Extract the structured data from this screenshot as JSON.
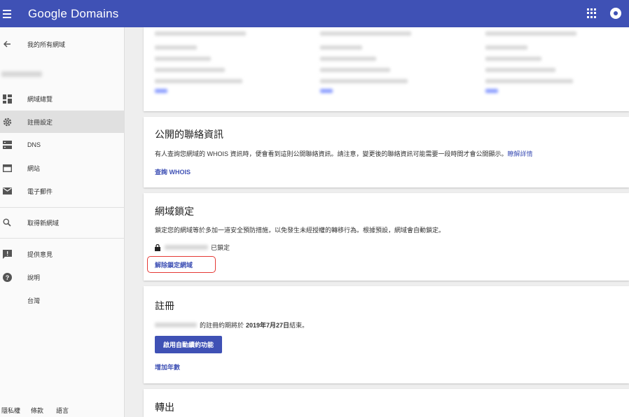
{
  "app": {
    "title": "Google Domains",
    "accent": "#3f51b5",
    "highlight_color": "#e53935"
  },
  "topbar": {
    "menu_icon": "menu-icon",
    "apps_icon": "apps-grid-icon",
    "account_icon": "account-icon"
  },
  "sidebar": {
    "back_label": "我的所有網域",
    "items": [
      {
        "label": "網域總覽",
        "icon": "dashboard-icon"
      },
      {
        "label": "註冊設定",
        "icon": "gear-icon"
      },
      {
        "label": "DNS",
        "icon": "dns-icon"
      },
      {
        "label": "網站",
        "icon": "web-icon"
      },
      {
        "label": "電子郵件",
        "icon": "email-icon"
      },
      {
        "label": "取得新網域",
        "icon": "search-icon"
      },
      {
        "label": "提供意見",
        "icon": "feedback-icon"
      },
      {
        "label": "說明",
        "icon": "help-icon"
      },
      {
        "label": "台灣"
      }
    ],
    "footer": [
      "隱私權",
      "條款",
      "語言"
    ]
  },
  "contact_card": {
    "title": "公開的聯絡資訊",
    "description": "有人查詢您網域的 WHOIS 資訊時，便會看到這則公開聯絡資訊。請注意，變更後的聯絡資訊可能需要一段時間才會公開顯示。",
    "learn_more": "瞭解詳情",
    "whois_link": "查詢 WHOIS"
  },
  "lock_card": {
    "title": "網域鎖定",
    "description": "鎖定您的網域等於多加一道安全預防措施，以免發生未經授權的轉移行為。根據預設，網域會自動鎖定。",
    "lock_icon": "lock-icon",
    "status": "已鎖定",
    "unlock_link": "解除鎖定網域"
  },
  "registration_card": {
    "title": "註冊",
    "expiry_prefix": "的註冊約期將於",
    "expiry_date": "2019年7月27日",
    "expiry_suffix": "結束。",
    "autorenew_button": "啟用自動續約功能",
    "add_years": "增加年數"
  },
  "transfer_card": {
    "title": "轉出"
  }
}
